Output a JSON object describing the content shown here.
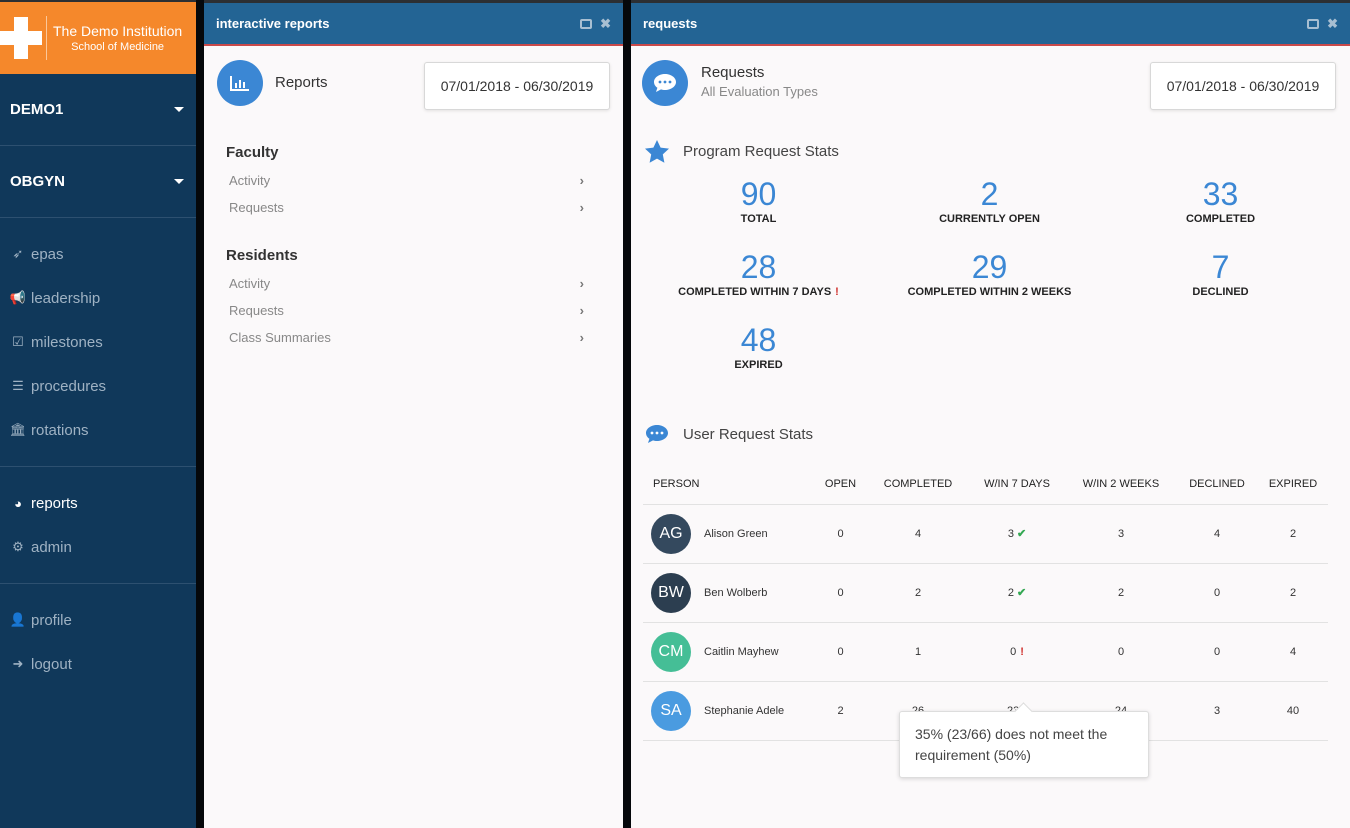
{
  "brand": {
    "line1": "The Demo Institution",
    "line2": "School of Medicine",
    "color": "#f5882b"
  },
  "sidebar": {
    "selectors": [
      {
        "label": "DEMO1"
      },
      {
        "label": "OBGYN"
      }
    ],
    "groups": [
      [
        {
          "label": "epas",
          "icon": "rocket-icon"
        },
        {
          "label": "leadership",
          "icon": "bullhorn-icon"
        },
        {
          "label": "milestones",
          "icon": "checkbox-icon"
        },
        {
          "label": "procedures",
          "icon": "tasks-icon"
        },
        {
          "label": "rotations",
          "icon": "institution-icon"
        }
      ],
      [
        {
          "label": "reports",
          "icon": "dashboard-icon",
          "active": true
        },
        {
          "label": "admin",
          "icon": "gear-icon"
        }
      ],
      [
        {
          "label": "profile",
          "icon": "user-icon"
        },
        {
          "label": "logout",
          "icon": "sign-out-icon"
        }
      ]
    ]
  },
  "reports_panel": {
    "title": "interactive reports",
    "heading": "Reports",
    "date_range": "07/01/2018 - 06/30/2019",
    "sections": [
      {
        "title": "Faculty",
        "links": [
          "Activity",
          "Requests"
        ]
      },
      {
        "title": "Residents",
        "links": [
          "Activity",
          "Requests",
          "Class Summaries"
        ]
      }
    ]
  },
  "requests_panel": {
    "title": "requests",
    "heading": "Requests",
    "subheading": "All Evaluation Types",
    "date_range": "07/01/2018 - 06/30/2019",
    "program_stats_title": "Program Request Stats",
    "program_stats": [
      {
        "value": "90",
        "label": "TOTAL"
      },
      {
        "value": "2",
        "label": "CURRENTLY OPEN"
      },
      {
        "value": "33",
        "label": "COMPLETED"
      },
      {
        "value": "28",
        "label": "COMPLETED WITHIN 7 DAYS",
        "flag": "warning"
      },
      {
        "value": "29",
        "label": "COMPLETED WITHIN 2 WEEKS"
      },
      {
        "value": "7",
        "label": "DECLINED"
      },
      {
        "value": "48",
        "label": "EXPIRED"
      }
    ],
    "user_stats_title": "User Request Stats",
    "columns": [
      "PERSON",
      "OPEN",
      "COMPLETED",
      "W/IN 7 DAYS",
      "W/IN 2 WEEKS",
      "DECLINED",
      "EXPIRED"
    ],
    "rows": [
      {
        "initials": "AG",
        "name": "Alison Green",
        "avatar_color": "#34495e",
        "open": "0",
        "completed": "4",
        "w7": "3",
        "w7_status": "ok",
        "w2": "3",
        "declined": "4",
        "expired": "2"
      },
      {
        "initials": "BW",
        "name": "Ben Wolberb",
        "avatar_color": "#2c3e50",
        "open": "0",
        "completed": "2",
        "w7": "2",
        "w7_status": "ok",
        "w2": "2",
        "declined": "0",
        "expired": "2"
      },
      {
        "initials": "CM",
        "name": "Caitlin Mayhew",
        "avatar_color": "#45be96",
        "open": "0",
        "completed": "1",
        "w7": "0",
        "w7_status": "warning",
        "w2": "0",
        "declined": "0",
        "expired": "4"
      },
      {
        "initials": "SA",
        "name": "Stephanie Adele",
        "avatar_color": "#4a9be0",
        "open": "2",
        "completed": "26",
        "w7": "23",
        "w7_status": "warning",
        "w2": "24",
        "declined": "3",
        "expired": "40"
      }
    ],
    "tooltip": "35% (23/66) does not meet the requirement (50%)"
  }
}
